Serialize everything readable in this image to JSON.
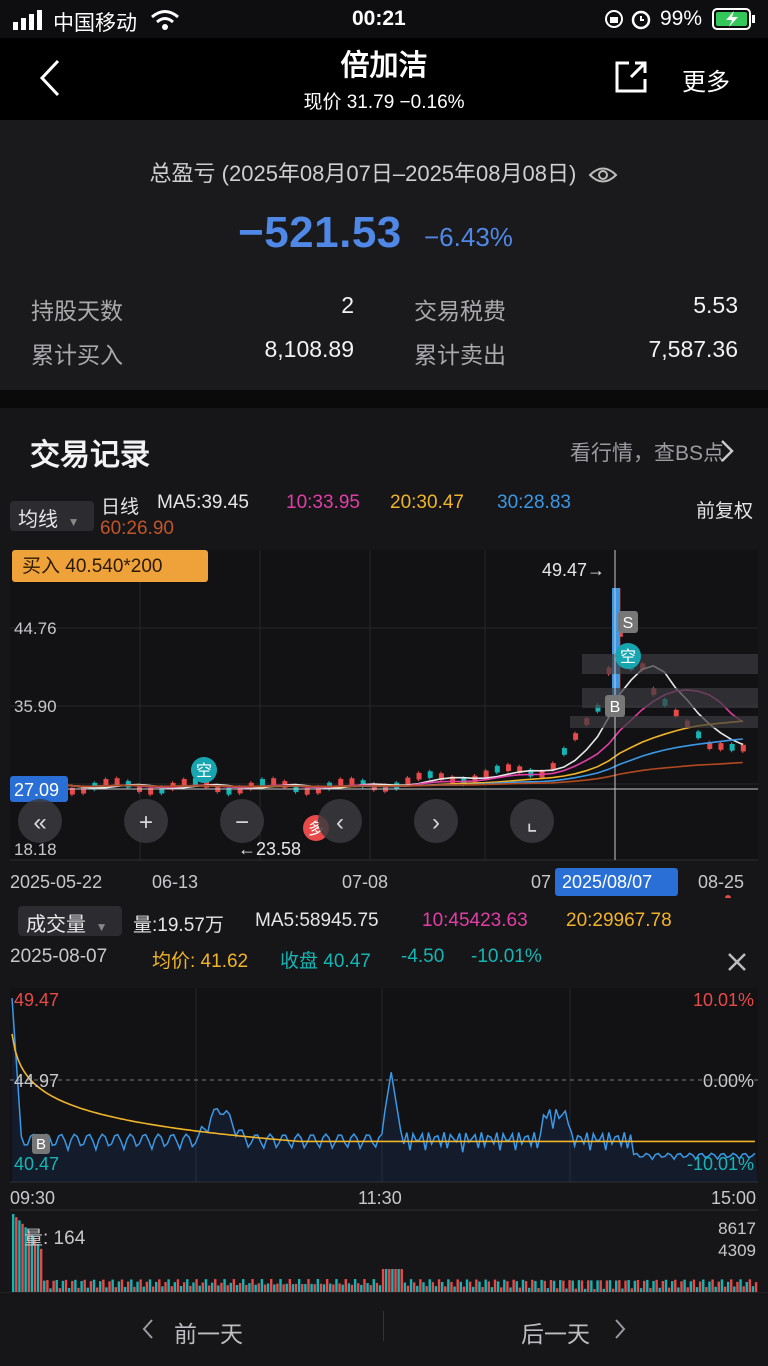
{
  "status": {
    "carrier": "中国移动",
    "time": "00:21",
    "battery": "99%"
  },
  "nav": {
    "title": "倍加洁",
    "subtitle": "现价 31.79 −0.16%",
    "more": "更多"
  },
  "pl": {
    "title": "总盈亏 (2025年08月07日–2025年08月08日)",
    "value": "−521.53",
    "percent": "−6.43%",
    "stats": [
      {
        "label": "持股天数",
        "value": "2"
      },
      {
        "label": "交易税费",
        "value": "5.53"
      },
      {
        "label": "累计买入",
        "value": "8,108.89"
      },
      {
        "label": "累计卖出",
        "value": "7,587.36"
      }
    ]
  },
  "records": {
    "title": "交易记录",
    "link": "看行情，查BS点"
  },
  "kline": {
    "ma_select": "均线",
    "period": "日线",
    "ma5": "MA5:39.45",
    "ma10": "10:33.95",
    "ma20": "20:30.47",
    "ma30": "30:28.83",
    "ma60": "60:26.90",
    "adjust": "前复权",
    "buy_tip": "买入 40.540*200",
    "price_labels": [
      "44.76",
      "35.90",
      "27.09",
      "18.18"
    ],
    "high_label": "49.47→",
    "low_label": "←23.58",
    "dates": [
      "2025-05-22",
      "06-13",
      "07-08",
      "07",
      "2025/08/07",
      "08-25"
    ],
    "marks": {
      "kong": "空",
      "s": "S",
      "b": "B",
      "duo": "多"
    },
    "colors": {
      "ma5": "#e8e8e8",
      "ma10": "#e23ea7",
      "ma20": "#f0b429",
      "ma30": "#3a98e6",
      "ma60": "#b34a1f",
      "up": "#e84a4a",
      "down": "#16b5b5"
    }
  },
  "volume_bar": {
    "select": "成交量",
    "vol": "量:19.57万",
    "ma5": "MA5:58945.75",
    "ma10": "10:45423.63",
    "ma20": "20:29967.78"
  },
  "intraday": {
    "date": "2025-08-07",
    "avg": "均价: 41.62",
    "close": "收盘 40.47",
    "chg": "-4.50",
    "chg_pct": "-10.01%",
    "price_labels": [
      "49.47",
      "44.97",
      "40.47"
    ],
    "pct_labels": [
      "10.01%",
      "0.00%",
      "-10.01%"
    ],
    "times": [
      "09:30",
      "11:30",
      "15:00"
    ],
    "vol_label": "量: 164",
    "vol_max": [
      "8617",
      "4309"
    ],
    "b_mark": "B"
  },
  "bottom": {
    "prev": "前一天",
    "next": "后一天"
  }
}
